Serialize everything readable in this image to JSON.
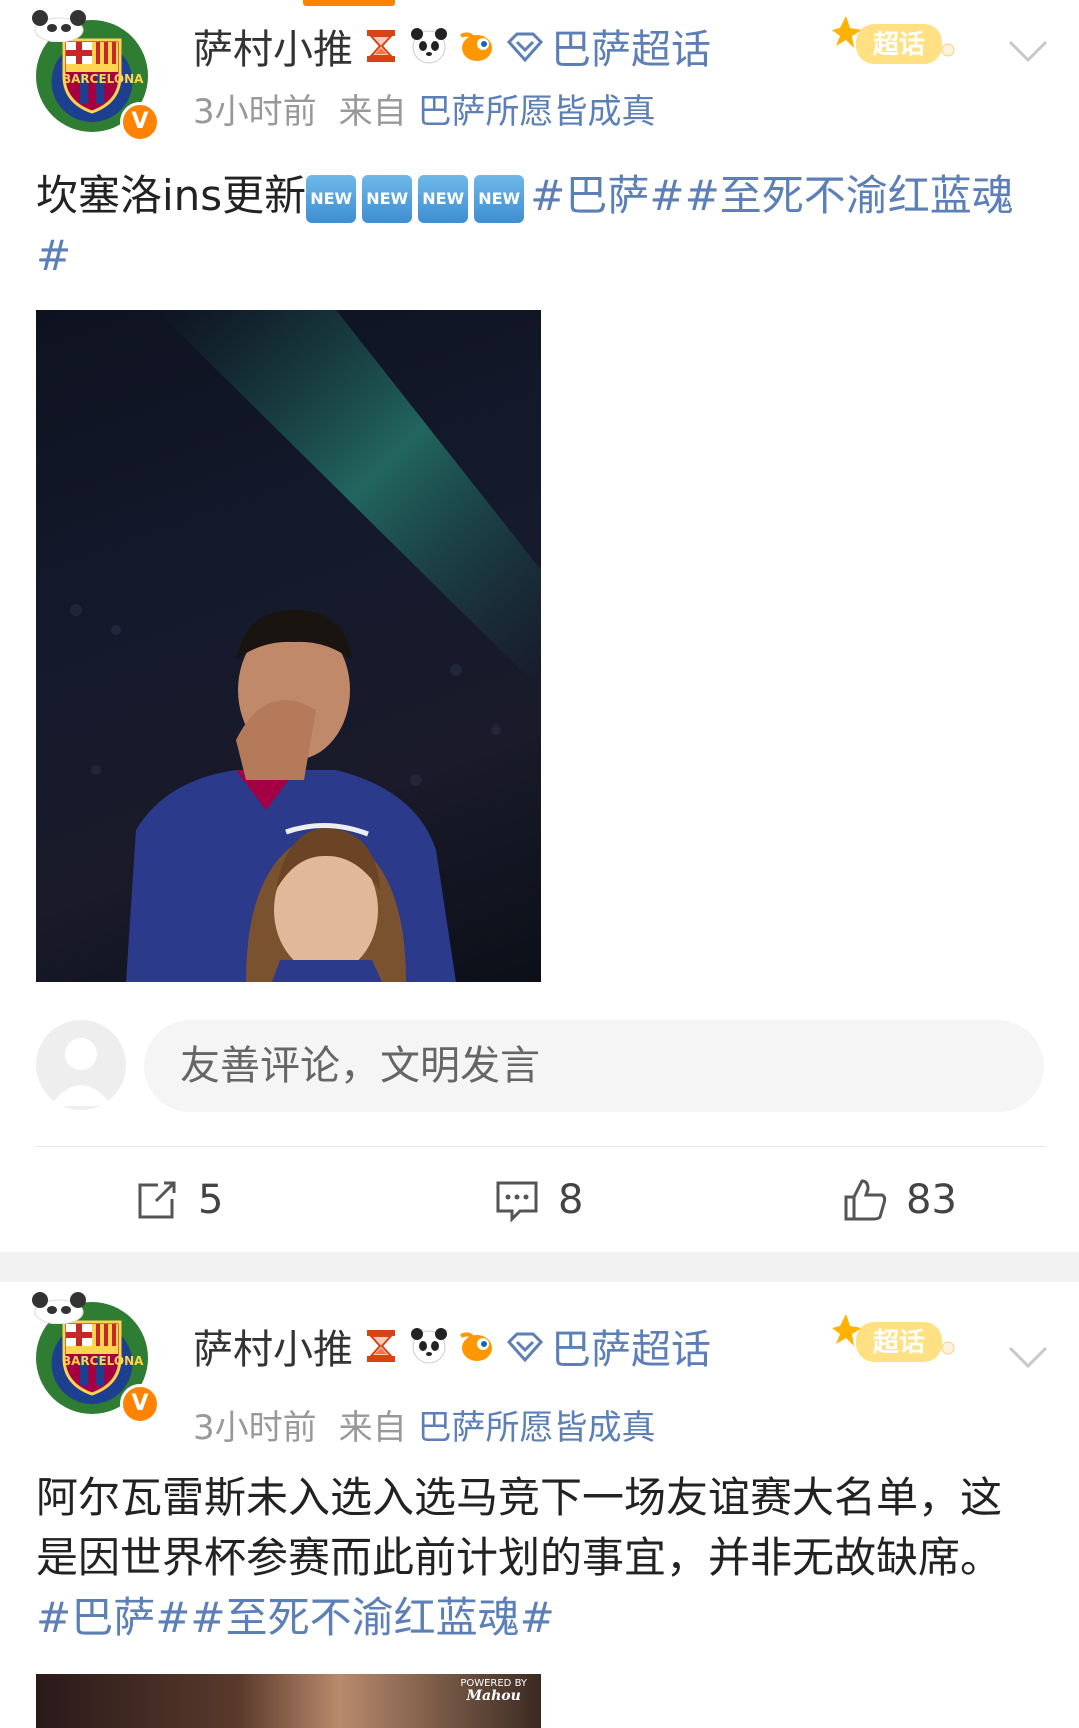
{
  "posts": [
    {
      "username": "萨村小推",
      "medal_icons": [
        "hourglass-icon",
        "panda-icon",
        "goldfish-icon"
      ],
      "super_topic_link": "巴萨超话",
      "time": "3小时前",
      "source_prefix": "来自",
      "source": "巴萨所愿皆成真",
      "chaohua_badge": "超话",
      "verified_badge": "V",
      "text": "坎塞洛ins更新",
      "new_badges": [
        "NEW",
        "NEW",
        "NEW",
        "NEW"
      ],
      "hashtags": [
        "#巴萨#",
        "#至死不渝红蓝魂#"
      ],
      "comment_placeholder": "友善评论，文明发言",
      "repost_count": "5",
      "comment_count": "8",
      "like_count": "83"
    },
    {
      "username": "萨村小推",
      "medal_icons": [
        "hourglass-icon",
        "panda-icon",
        "goldfish-icon"
      ],
      "super_topic_link": "巴萨超话",
      "time": "3小时前",
      "source_prefix": "来自",
      "source": "巴萨所愿皆成真",
      "chaohua_badge": "超话",
      "verified_badge": "V",
      "text": "阿尔瓦雷斯未入选入选马竞下一场友谊赛大名单，这是因世界杯参赛而此前计划的事宜，并非无故缺席。",
      "hashtags": [
        "#巴萨#",
        "#至死不渝红蓝魂#"
      ],
      "photo_logo_top": "POWERED BY",
      "photo_logo_brand": "Mahou"
    }
  ],
  "colors": {
    "accent": "#ff8200",
    "link": "#5b7fb6",
    "divider": "#f2f2f2"
  }
}
